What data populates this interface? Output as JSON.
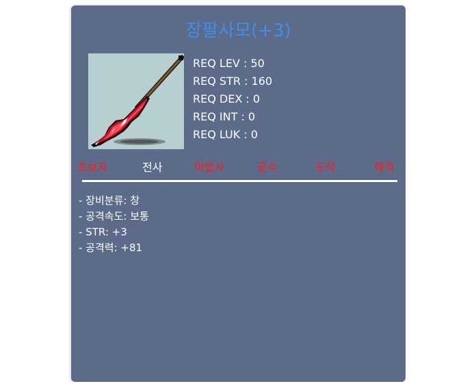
{
  "item": {
    "name": "장팔사모(+3)",
    "icon": "spear-icon"
  },
  "requirements": [
    {
      "text": "REQ LEV : 50"
    },
    {
      "text": "REQ STR : 160"
    },
    {
      "text": "REQ DEX : 0"
    },
    {
      "text": "REQ INT : 0"
    },
    {
      "text": "REQ LUK : 0"
    }
  ],
  "jobs": [
    {
      "label": "초보자",
      "allowed": false
    },
    {
      "label": "전사",
      "allowed": true
    },
    {
      "label": "마법사",
      "allowed": false
    },
    {
      "label": "궁수",
      "allowed": false
    },
    {
      "label": "도적",
      "allowed": false
    },
    {
      "label": "해적",
      "allowed": false
    }
  ],
  "stats": [
    "- 장비분류: 창",
    "- 공격속도: 보통",
    "- STR: +3",
    "- 공격력: +81"
  ],
  "colors": {
    "panel_bg": "#5c6b8a",
    "title": "#3d8fe8",
    "job_denied": "#ff1a1a",
    "job_allowed": "#ffffff",
    "icon_bg": "#b8cfd1"
  }
}
